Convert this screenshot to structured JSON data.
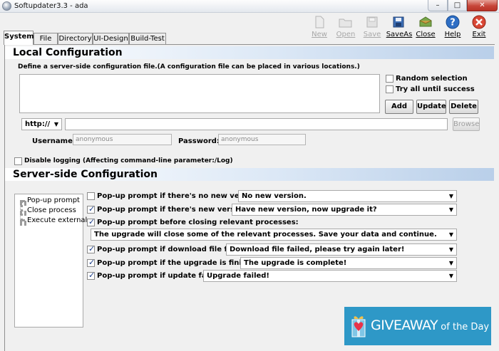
{
  "window": {
    "title": "Softupdater3.3 - ada",
    "min_glyph": "–",
    "max_glyph": "□",
    "close_glyph": "✕"
  },
  "tabs": [
    {
      "label": "System",
      "active": true
    },
    {
      "label": "File",
      "active": false
    },
    {
      "label": "Directory",
      "active": false
    },
    {
      "label": "UI-Design",
      "active": false
    },
    {
      "label": "Build-Test",
      "active": false
    }
  ],
  "toolbar": {
    "new": "New",
    "open": "Open",
    "save": "Save",
    "saveas": "SaveAs",
    "close": "Close",
    "help": "Help",
    "exit": "Exit"
  },
  "local": {
    "heading": "Local Configuration",
    "description": "Define a server-side configuration file.(A configuration file can be placed in various locations.)",
    "random_selection": "Random selection",
    "try_all": "Try all until success",
    "add": "Add",
    "update": "Update",
    "delete": "Delete",
    "protocol": "http://",
    "browse": "Browse",
    "username_label": "Username:",
    "username_value": "anonymous",
    "password_label": "Password:",
    "password_value": "anonymous",
    "disable_logging": "Disable logging (Affecting command-line parameter:/Log)"
  },
  "server": {
    "heading": "Server-side Configuration",
    "tree": [
      "Pop-up prompt",
      "Close process",
      "Execute external"
    ],
    "options": [
      {
        "label": "Pop-up prompt if there's no new version:",
        "value": "No new version.",
        "checked": false
      },
      {
        "label": "Pop-up prompt if there's new version:",
        "value": "Have new version, now upgrade it?",
        "checked": true
      },
      {
        "label": "Pop-up prompt before closing relevant processes:",
        "value": "The upgrade will close some of the relevant processes. Save your data and continue.",
        "checked": true
      },
      {
        "label": "Pop-up prompt if download file failed:",
        "value": "Download file failed, please try again later!",
        "checked": true
      },
      {
        "label": "Pop-up prompt if the upgrade is finished:",
        "value": "The upgrade is complete!",
        "checked": true
      },
      {
        "label": "Pop-up prompt if update failed:",
        "value": "Upgrade failed!",
        "checked": true
      }
    ]
  },
  "watermark": {
    "big": "GIVEAWAY",
    "small": " of the Day"
  },
  "colors": {
    "accent": "#2e98c7",
    "section_gradient_end": "#b9cfe9",
    "close_red": "#c7463a"
  },
  "icons": {
    "new": "new-file-icon",
    "open": "open-folder-icon",
    "save": "save-disk-icon",
    "saveas": "save-as-icon",
    "close": "close-document-icon",
    "help": "help-icon",
    "exit": "exit-icon",
    "dropdown": "chevron-down-icon"
  }
}
